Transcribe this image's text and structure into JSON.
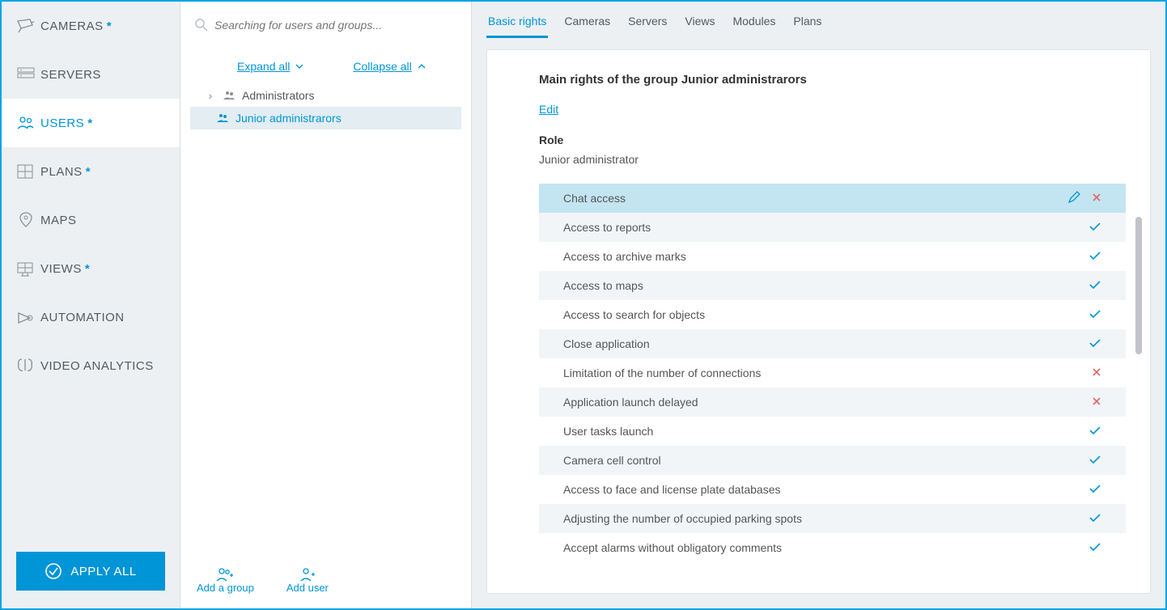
{
  "sidebar": {
    "items": [
      {
        "label": "CAMERAS",
        "star": true
      },
      {
        "label": "SERVERS",
        "star": false
      },
      {
        "label": "USERS",
        "star": true
      },
      {
        "label": "PLANS",
        "star": true
      },
      {
        "label": "MAPS",
        "star": false
      },
      {
        "label": "VIEWS",
        "star": true
      },
      {
        "label": "AUTOMATION",
        "star": false
      },
      {
        "label": "VIDEO ANALYTICS",
        "star": false
      }
    ],
    "apply_label": "APPLY ALL"
  },
  "mid": {
    "search_placeholder": "Searching for users and groups...",
    "expand_label": "Expand all",
    "collapse_label": "Collapse all",
    "tree": [
      {
        "label": "Administrators"
      },
      {
        "label": "Junior administrarors"
      }
    ],
    "footer": {
      "add_group": "Add a group",
      "add_user": "Add user"
    }
  },
  "right": {
    "tabs": [
      "Basic rights",
      "Cameras",
      "Servers",
      "Views",
      "Modules",
      "Plans"
    ],
    "title": "Main rights of the group Junior administrarors",
    "edit_label": "Edit",
    "role_label": "Role",
    "role_value": "Junior administrator",
    "perms": [
      {
        "label": "Chat access",
        "state": "x",
        "selected": true
      },
      {
        "label": "Access to reports",
        "state": "check"
      },
      {
        "label": "Access to archive marks",
        "state": "check"
      },
      {
        "label": "Access to maps",
        "state": "check"
      },
      {
        "label": "Access to search for objects",
        "state": "check"
      },
      {
        "label": "Close application",
        "state": "check"
      },
      {
        "label": "Limitation of the number of connections",
        "state": "x"
      },
      {
        "label": "Application launch delayed",
        "state": "x"
      },
      {
        "label": "User tasks launch",
        "state": "check"
      },
      {
        "label": "Camera cell control",
        "state": "check"
      },
      {
        "label": "Access to face and license plate databases",
        "state": "check"
      },
      {
        "label": "Adjusting the number of occupied parking spots",
        "state": "check"
      },
      {
        "label": "Accept alarms without obligatory comments",
        "state": "check"
      }
    ]
  }
}
